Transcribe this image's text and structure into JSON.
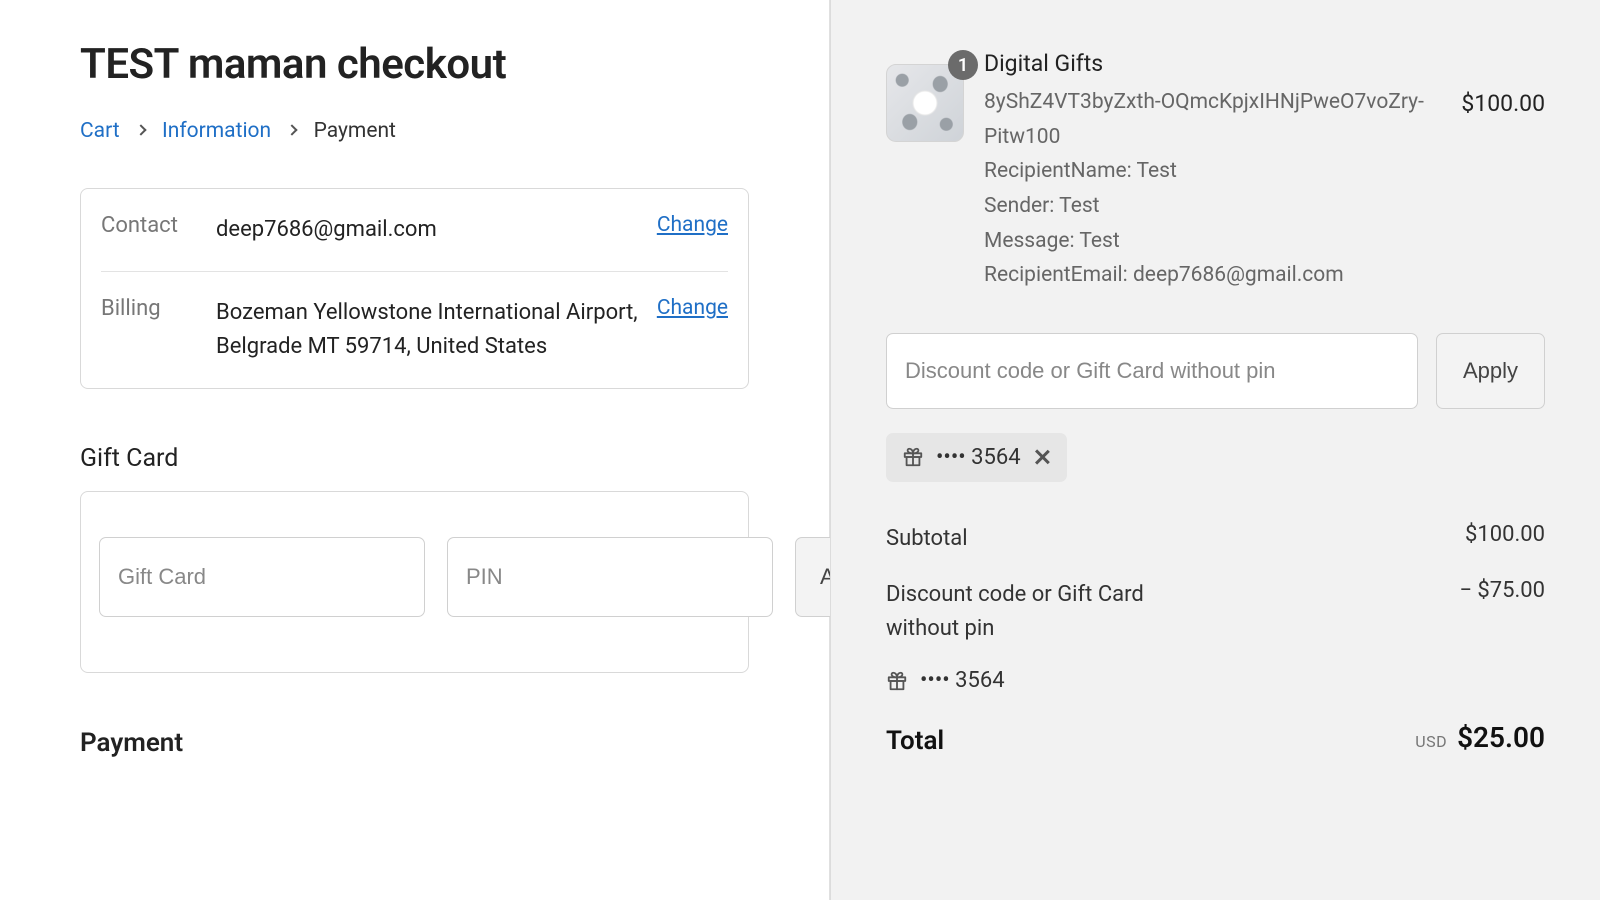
{
  "header": {
    "title": "TEST maman checkout"
  },
  "breadcrumb": {
    "cart": "Cart",
    "information": "Information",
    "payment": "Payment"
  },
  "review": {
    "contact_label": "Contact",
    "contact_value": "deep7686@gmail.com",
    "billing_label": "Billing",
    "billing_value": "Bozeman Yellowstone International Airport, Belgrade MT 59714, United States",
    "change_label": "Change"
  },
  "giftcard": {
    "section_title": "Gift Card",
    "card_placeholder": "Gift Card",
    "pin_placeholder": "PIN",
    "apply_label": "Apply"
  },
  "payment_section": {
    "title": "Payment"
  },
  "cart": {
    "item": {
      "qty": "1",
      "title": "Digital Gifts",
      "line1": "8yShZ4VT3byZxth-OQmcKpjxIHNjPweO7voZry-Pitw100",
      "line2": "RecipientName: Test",
      "line3": "Sender: Test",
      "line4": "Message: Test",
      "line5": "RecipientEmail: deep7686@gmail.com",
      "price": "$100.00"
    },
    "discount_placeholder": "Discount code or Gift Card without pin",
    "apply_label": "Apply",
    "applied_tag_text": "•••• 3564"
  },
  "summary": {
    "subtotal_label": "Subtotal",
    "subtotal_value": "$100.00",
    "discount_label": "Discount code or Gift Card without pin",
    "discount_value": "− $75.00",
    "applied_code": "•••• 3564",
    "total_label": "Total",
    "currency": "USD",
    "total_value": "$25.00"
  }
}
